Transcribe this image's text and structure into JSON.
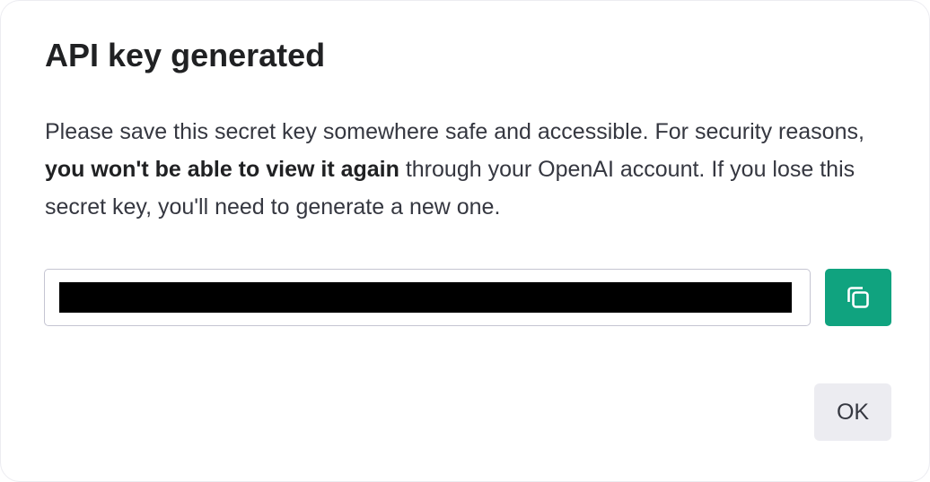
{
  "dialog": {
    "title": "API key generated",
    "message": {
      "before": "Please save this secret key somewhere safe and accessible. For security reasons, ",
      "emphasis": "you won't be able to view it again",
      "after": " through your OpenAI account. If you lose this secret key, you'll need to generate a new one."
    },
    "key_field": {
      "value": "",
      "redacted": true
    },
    "copy_button": {
      "icon": "copy-icon",
      "color": "#10a37f"
    },
    "ok_label": "OK"
  }
}
